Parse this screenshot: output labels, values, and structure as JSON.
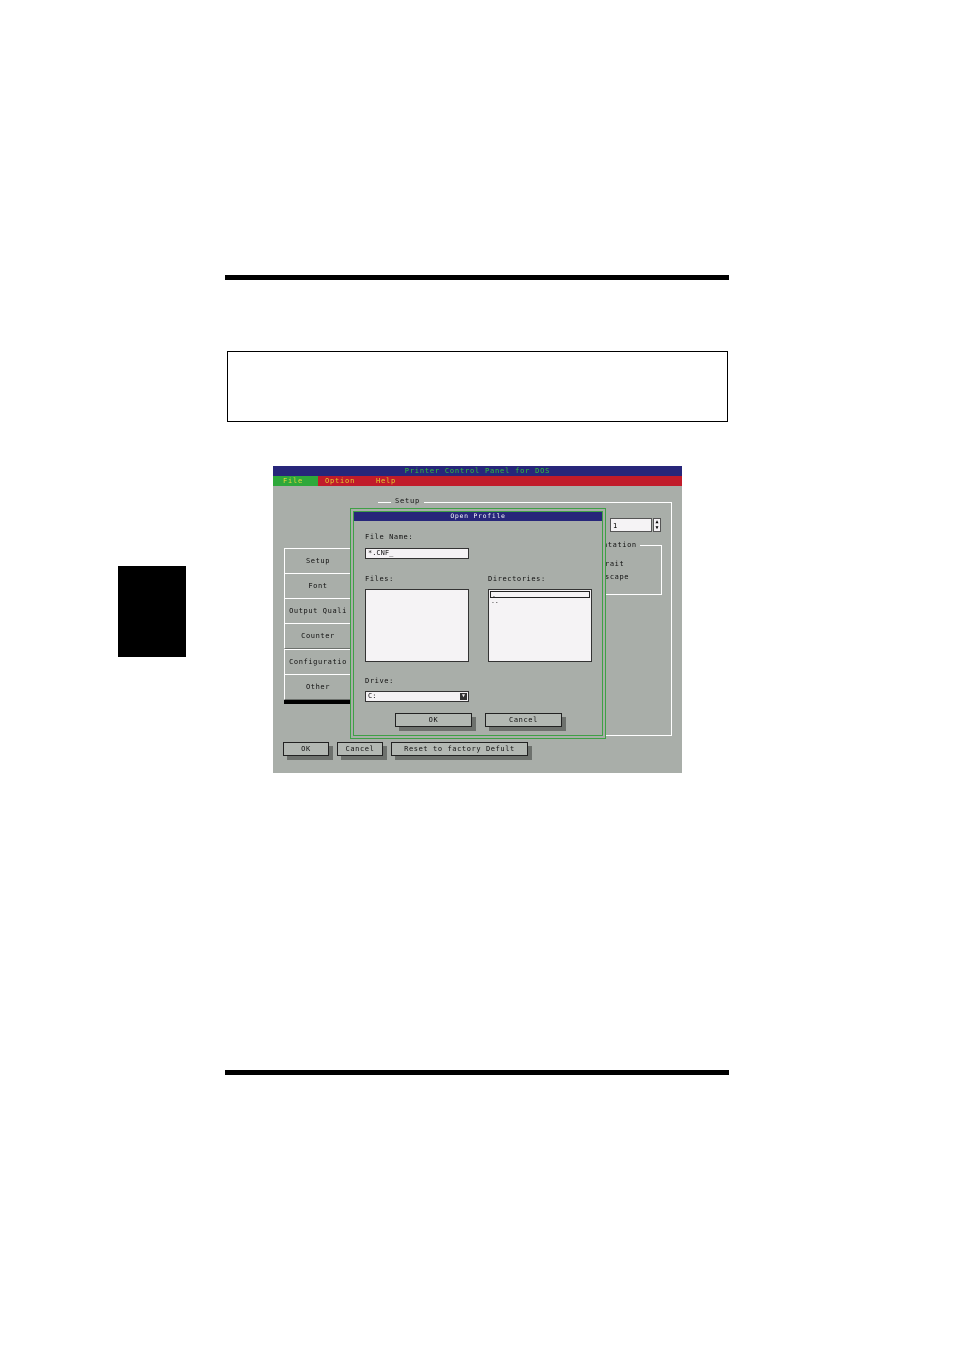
{
  "app": {
    "title": "Printer Control Panel for DOS",
    "menu": [
      "File",
      "Option",
      "Help"
    ]
  },
  "setup_panel": {
    "legend": "Setup",
    "tabs": [
      "Setup",
      "Font",
      "Output Quali",
      "Counter",
      "Configuratio",
      "Other"
    ],
    "spin_value": "1",
    "orientation_label": "ntation",
    "orientation_options": [
      "rait",
      "scape"
    ],
    "buttons": {
      "ok": "OK",
      "cancel": "Cancel",
      "reset": "Reset to factory Defult"
    }
  },
  "dialog": {
    "title": "Open Profile",
    "file_name_label": "File Name:",
    "file_name_value": "*.CNF_",
    "files_label": "Files:",
    "directories_label": "Directories:",
    "directories": [
      ".",
      ".."
    ],
    "drive_label": "Drive:",
    "drive_value": "C:",
    "ok_label": "OK",
    "cancel_label": "Cancel"
  },
  "colors": {
    "title_bar": "#27267a",
    "title_text": "#2fc43a",
    "menu_bar": "#c11b2a",
    "menu_selected": "#2ea83a",
    "window_bg": "#a9aea9"
  }
}
